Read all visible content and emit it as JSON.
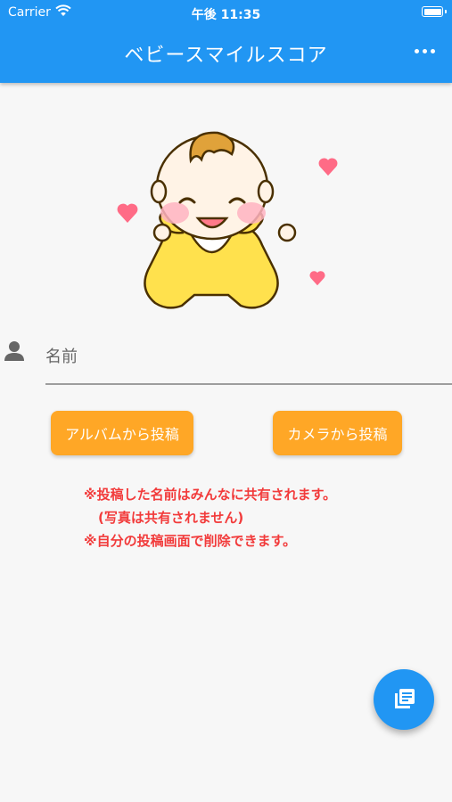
{
  "status_bar": {
    "carrier": "Carrier",
    "time": "午後 11:35"
  },
  "app_bar": {
    "title": "ベビースマイルスコア",
    "background": "#2196f3"
  },
  "name_field": {
    "placeholder": "名前",
    "value": ""
  },
  "buttons": {
    "album": "アルバムから投稿",
    "camera": "カメラから投稿",
    "color": "#ffa726"
  },
  "notes": {
    "line1": "※投稿した名前はみんなに共有されます。",
    "line2": "(写真は共有されません)",
    "line3": "※自分の投稿画面で削除できます。",
    "color": "#f23b3b"
  },
  "icons": {
    "fab": "library-books-icon",
    "person": "person-icon",
    "more": "more-horizontal-icon"
  }
}
